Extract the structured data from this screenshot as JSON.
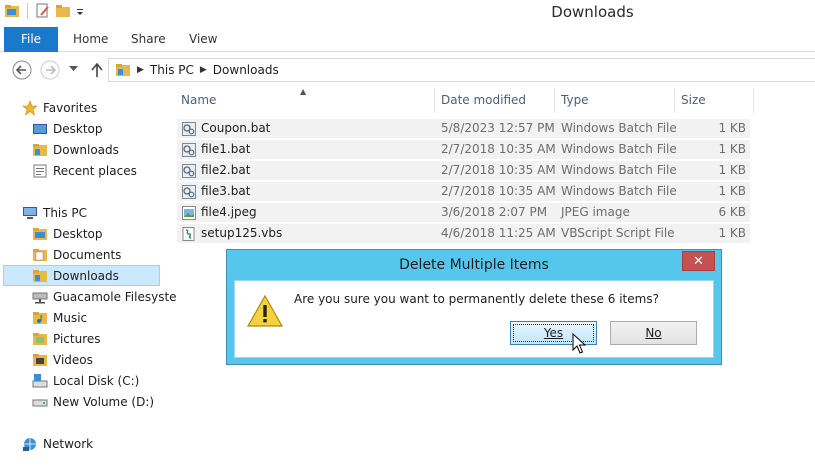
{
  "window": {
    "title": "Downloads"
  },
  "ribbon": {
    "tabs": [
      "File",
      "Home",
      "Share",
      "View"
    ]
  },
  "address": {
    "crumbs": [
      "This PC",
      "Downloads"
    ]
  },
  "nav": {
    "favorites_label": "Favorites",
    "favorites": [
      "Desktop",
      "Downloads",
      "Recent places"
    ],
    "thispc_label": "This PC",
    "thispc": [
      "Desktop",
      "Documents",
      "Downloads",
      "Guacamole Filesyste",
      "Music",
      "Pictures",
      "Videos",
      "Local Disk (C:)",
      "New Volume (D:)"
    ],
    "network_label": "Network",
    "selected": "Downloads"
  },
  "columns": [
    "Name",
    "Date modified",
    "Type",
    "Size"
  ],
  "files": [
    {
      "name": "Coupon.bat",
      "date": "5/8/2023 12:57 PM",
      "type": "Windows Batch File",
      "size": "1 KB",
      "icon": "batch-file-icon"
    },
    {
      "name": "file1.bat",
      "date": "2/7/2018 10:35 AM",
      "type": "Windows Batch File",
      "size": "1 KB",
      "icon": "batch-file-icon"
    },
    {
      "name": "file2.bat",
      "date": "2/7/2018 10:35 AM",
      "type": "Windows Batch File",
      "size": "1 KB",
      "icon": "batch-file-icon"
    },
    {
      "name": "file3.bat",
      "date": "2/7/2018 10:35 AM",
      "type": "Windows Batch File",
      "size": "1 KB",
      "icon": "batch-file-icon"
    },
    {
      "name": "file4.jpeg",
      "date": "3/6/2018 2:07 PM",
      "type": "JPEG image",
      "size": "6 KB",
      "icon": "image-file-icon"
    },
    {
      "name": "setup125.vbs",
      "date": "4/6/2018 11:25 AM",
      "type": "VBScript Script File",
      "size": "1 KB",
      "icon": "script-file-icon"
    }
  ],
  "dialog": {
    "title": "Delete Multiple Items",
    "close_label": "✕",
    "message": "Are you sure you want to permanently delete these 6 items?",
    "yes_label": "Yes",
    "no_label": "No",
    "icon": "warning-icon"
  },
  "colors": {
    "accent": "#1979ca",
    "dialog_frame": "#56c7ec",
    "selection": "#cce8ff",
    "close_red": "#c75050"
  }
}
